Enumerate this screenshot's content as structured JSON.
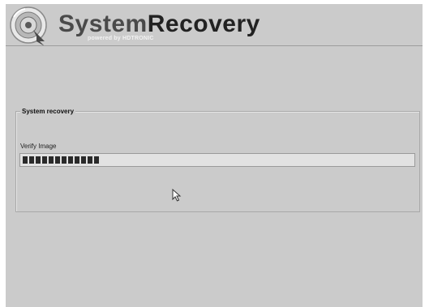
{
  "app": {
    "logo_icon": "recovery-disc-arrow-icon",
    "title_part1": "System",
    "title_part2": "Recovery",
    "tagline": "powered by HDTRONIC"
  },
  "panel": {
    "title": "System recovery",
    "status_label": "Verify Image",
    "progress": {
      "filled_blocks": 12,
      "fraction": 0.2
    }
  },
  "cursor": {
    "icon": "mouse-pointer-icon"
  },
  "colors": {
    "background": "#cbcbcb",
    "progress_track": "#e2e2e2",
    "progress_fill": "#2a2a2a"
  }
}
